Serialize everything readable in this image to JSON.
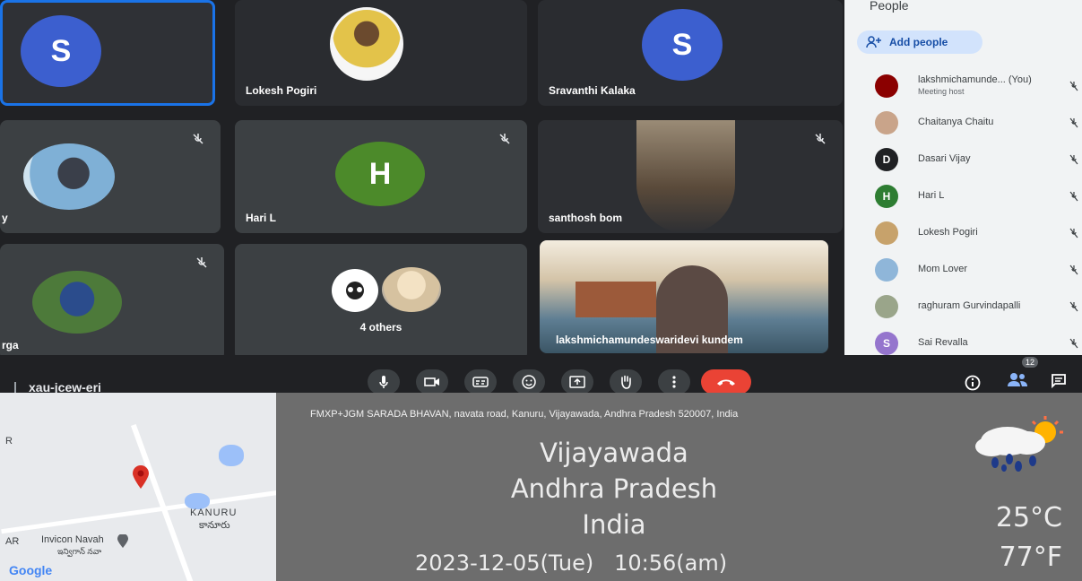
{
  "tiles": {
    "s_top_initial": "S",
    "lokesh_name": "Lokesh Pogiri",
    "sravanthi_initial": "S",
    "sravanthi_name": "Sravanthi Kalaka",
    "hari_initial": "H",
    "hari_name": "Hari L",
    "santhosh_name": "santhosh bom",
    "durga_name": "rga",
    "others_label": "4 others",
    "host_tile_name": "lakshmichamundeswaridevi kundem",
    "left_tile_name": "y"
  },
  "people_panel": {
    "title": "People",
    "add_people_label": "Add people",
    "participants": [
      {
        "name": "lakshmichamunde... (You)",
        "sub": "Meeting host",
        "initial": "",
        "color": "#8b0000"
      },
      {
        "name": "Chaitanya Chaitu",
        "sub": "",
        "initial": "",
        "color": "#c9a48a"
      },
      {
        "name": "Dasari Vijay",
        "sub": "",
        "initial": "D",
        "color": "#202124"
      },
      {
        "name": "Hari L",
        "sub": "",
        "initial": "H",
        "color": "#2e7d32"
      },
      {
        "name": "Lokesh Pogiri",
        "sub": "",
        "initial": "",
        "color": "#c7a26b"
      },
      {
        "name": "Mom Lover",
        "sub": "",
        "initial": "",
        "color": "#8fb6d9"
      },
      {
        "name": "raghuram Gurvindapalli",
        "sub": "",
        "initial": "",
        "color": "#9aa58a"
      },
      {
        "name": "Sai Revalla",
        "sub": "",
        "initial": "S",
        "color": "#9575cd"
      }
    ]
  },
  "controls": {
    "meeting_code": "xau-jcew-eri",
    "people_count": "12"
  },
  "geotag": {
    "address": "FMXP+JGM SARADA BHAVAN, navata road, Kanuru, Vijayawada, Andhra Pradesh 520007, India",
    "city": "Vijayawada",
    "state": "Andhra Pradesh",
    "country": "India",
    "datetime": "2023-12-05(Tue)   10:56(am)",
    "temp_c": "25°C",
    "temp_f": "77°F"
  },
  "map": {
    "place_kanuru": "KANURU",
    "place_kanuru_te": "కానూరు",
    "place_invicon": "Invicon Navah",
    "place_invicon_te": "ఇన్విగాన్ నవా",
    "edge_top": "R",
    "edge_bottom": "AR",
    "google_logo": "Google"
  },
  "colors": {
    "meet_bg": "#202124",
    "tile_bg": "#3c4043",
    "end_call": "#ea4335",
    "avatar_s": "#3c5fcf",
    "avatar_h": "#4c8a2a"
  }
}
